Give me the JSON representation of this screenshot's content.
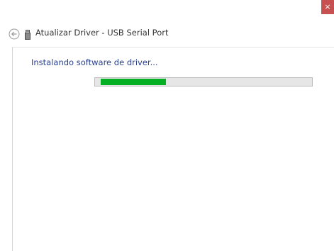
{
  "window": {
    "close_glyph": "×",
    "close_color": "#c75050"
  },
  "header": {
    "back_icon": "back-arrow-icon",
    "device_icon": "usb-device-icon",
    "title": "Atualizar Driver - USB Serial Port"
  },
  "content": {
    "status": "Instalando software de driver...",
    "progress_percent": 31,
    "progress_color": "#06b025"
  }
}
